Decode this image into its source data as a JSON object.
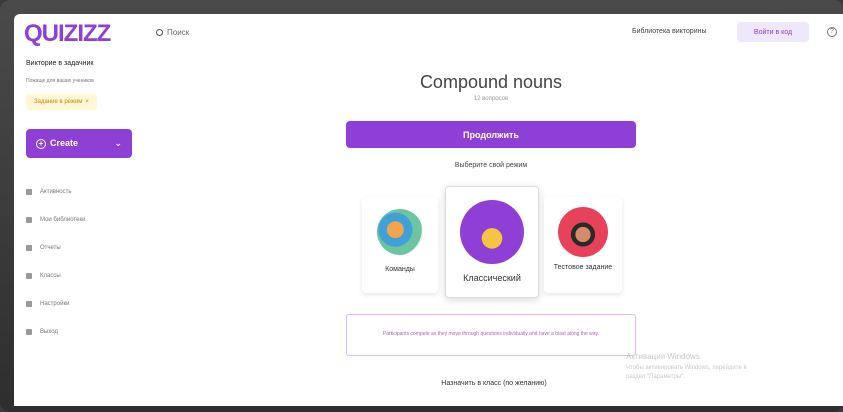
{
  "header": {
    "logo": "QUIZIZZ",
    "search_label": "Поиск",
    "library_link": "Библиотека викторины",
    "login_label": "Войти в код"
  },
  "sidebar": {
    "title": "Викторие в задачник",
    "subtitle": "Пожаще для ваших учеников",
    "badge": "Задание в режим",
    "create_label": "Create",
    "items": [
      {
        "label": "Активность",
        "icon": "activity-icon"
      },
      {
        "label": "Мои библиотеки",
        "icon": "library-icon"
      },
      {
        "label": "Отчеты",
        "icon": "reports-icon"
      },
      {
        "label": "Классы",
        "icon": "classes-icon"
      },
      {
        "label": "Настройки",
        "icon": "settings-icon"
      },
      {
        "label": "Выход",
        "icon": "logout-icon"
      }
    ]
  },
  "main": {
    "title": "Compound nouns",
    "subtitle": "12 вопросов",
    "continue_label": "Продолжить",
    "choose_label": "Выберите свой режим",
    "modes": [
      {
        "label": "Команды"
      },
      {
        "label": "Классический"
      },
      {
        "label": "Тестовое задание"
      }
    ],
    "info_text": "Participants compete as they move through questions individually and have a blast along the way.",
    "bottom_link": "Назначить в класс (по желанию)"
  },
  "watermark": {
    "line1": "Активация Windows",
    "line2": "Чтобы активировать Windows, перейдите в",
    "line3": "раздел \"Параметры\"."
  },
  "colors": {
    "brand": "#8e3fd6",
    "login_bg": "#efe7fb",
    "info_border": "#e0b8ee"
  }
}
